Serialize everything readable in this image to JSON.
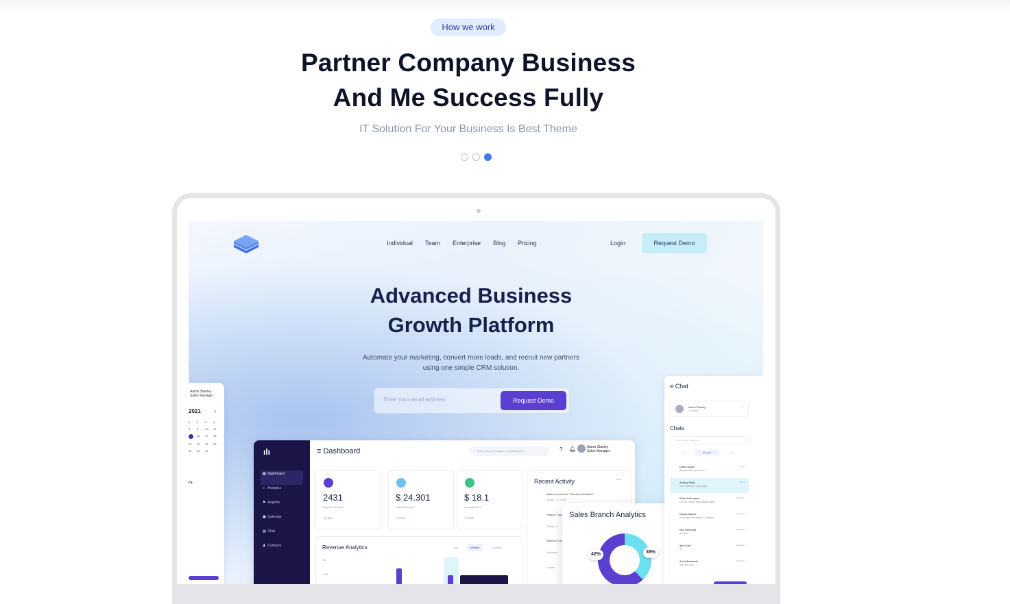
{
  "section": {
    "pill": "How we work",
    "title_line1": "Partner Company Business",
    "title_line2": "And Me Success Fully",
    "subtitle": "IT Solution For Your Business Is Best Theme",
    "carousel": {
      "total": 3,
      "active_index": 2
    }
  },
  "site": {
    "nav": [
      "Individual",
      "Team",
      "Enterprise",
      "Blog",
      "Pricing"
    ],
    "login": "Login",
    "request_demo": "Request Demo",
    "hero_title_line1": "Advanced Business",
    "hero_title_line2": "Growth Platform",
    "hero_text_line1": "Automate your marketing, convert more leads, and recruit new partners",
    "hero_text_line2": "using one simple CRM solution.",
    "email_placeholder": "Enter your email address",
    "email_button": "Request Demo"
  },
  "calendar": {
    "user_name": "Aaron Stanley",
    "user_role": "Sales Manager",
    "year": "2021",
    "days": [
      "1",
      "2",
      "3",
      "4",
      "8",
      "9",
      "10",
      "11",
      "15",
      "16",
      "17",
      "18",
      "22",
      "23",
      "24",
      "25",
      "29",
      "30",
      "31",
      ""
    ],
    "label": "rs"
  },
  "dashboard": {
    "title": "Dashboard",
    "search_placeholder": "Search report, analytic or anything here",
    "user_name": "Aaron Stanley",
    "user_role": "Sales Manager",
    "menu": [
      "Dashboard",
      "Analytics",
      "Reports",
      "Calendar",
      "Chat",
      "Contacts"
    ],
    "stats": [
      {
        "value": "2431",
        "label": "Number of Sales",
        "change": "1.8%",
        "color": "#5b3fd0"
      },
      {
        "value": "$ 24.301",
        "label": "Sales Revenue",
        "change": "3.0%",
        "color": "#6ec1f0"
      },
      {
        "value": "$ 18.1",
        "label": "Average Price",
        "change": "0.2%",
        "color": "#3cc38a"
      }
    ],
    "recent_title": "Recent Activity",
    "recent_items": [
      "Added an interest \"Volunteer Activities\"",
      "Today - 3:12 PM",
      "Respon Opport",
      "Today - 9",
      "Attende Event\"",
      "Yesterda",
      "Create"
    ],
    "revenue_title": "Revenue Analytics",
    "revenue_tabs": [
      "Day",
      "Weekly",
      "Monthly"
    ],
    "revenue_y": [
      "2k",
      "1.5k"
    ]
  },
  "sales_branch": {
    "title": "Sales Branch Analytics",
    "left_pct": "42%",
    "right_pct": "38%"
  },
  "chat": {
    "title": "Chat",
    "user_name": "Aaron Stanley",
    "user_status": "• Online",
    "chats_label": "Chats",
    "search_placeholder": "Search name, contact etc",
    "tabs": [
      "All",
      "Personal",
      "Team"
    ],
    "rows": [
      {
        "name": "David Nolan",
        "msg": "Aaaah! Are you here?",
        "time": "13.15"
      },
      {
        "name": "Audrey Kelly",
        "msg": "Ok, I will find it up then",
        "time": "14.21"
      },
      {
        "name": "Brian Artemayev",
        "msg": "Do you have that illegal data?",
        "time": "Yesterday"
      },
      {
        "name": "essica Naomi",
        "msg": "ll handle that Aaron, Thanks!",
        "time": "Yesterday"
      },
      {
        "name": "edo Greyhold",
        "msg": "ay fine",
        "time": "Yesterday"
      },
      {
        "name": "alia Chen",
        "msg": "hi",
        "time": "Yesterday"
      },
      {
        "name": "di Hadiuswanto",
        "msg": "ank you bro",
        "time": "Yesterday"
      }
    ]
  }
}
